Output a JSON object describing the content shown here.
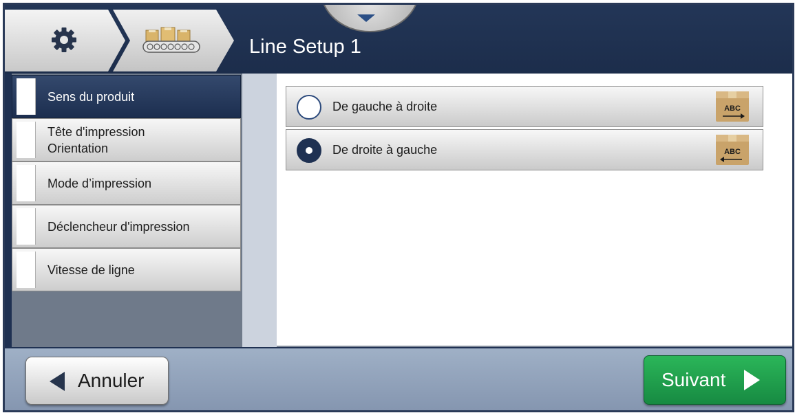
{
  "header": {
    "title": "Line Setup 1",
    "settings_icon": "gear-icon",
    "line_icon": "conveyor-icon",
    "pull_down_icon": "chevron-down-icon"
  },
  "sidebar": {
    "items": [
      {
        "label": "Sens du produit",
        "active": true
      },
      {
        "label": "Tête d'impression\nOrientation",
        "active": false
      },
      {
        "label": "Mode d’impression",
        "active": false
      },
      {
        "label": "Déclencheur d'impression",
        "active": false
      },
      {
        "label": "Vitesse de ligne",
        "active": false
      }
    ]
  },
  "options": [
    {
      "label": "De gauche à droite",
      "selected": false,
      "icon": "box-arrow-right-icon",
      "box_text": "ABC"
    },
    {
      "label": "De droite à gauche",
      "selected": true,
      "icon": "box-arrow-left-icon",
      "box_text": "ABC"
    }
  ],
  "footer": {
    "cancel_label": "Annuler",
    "next_label": "Suivant"
  },
  "colors": {
    "header_bg": "#1f3152",
    "accent_green": "#1e9c4c",
    "active_menu": "#263a5e"
  }
}
